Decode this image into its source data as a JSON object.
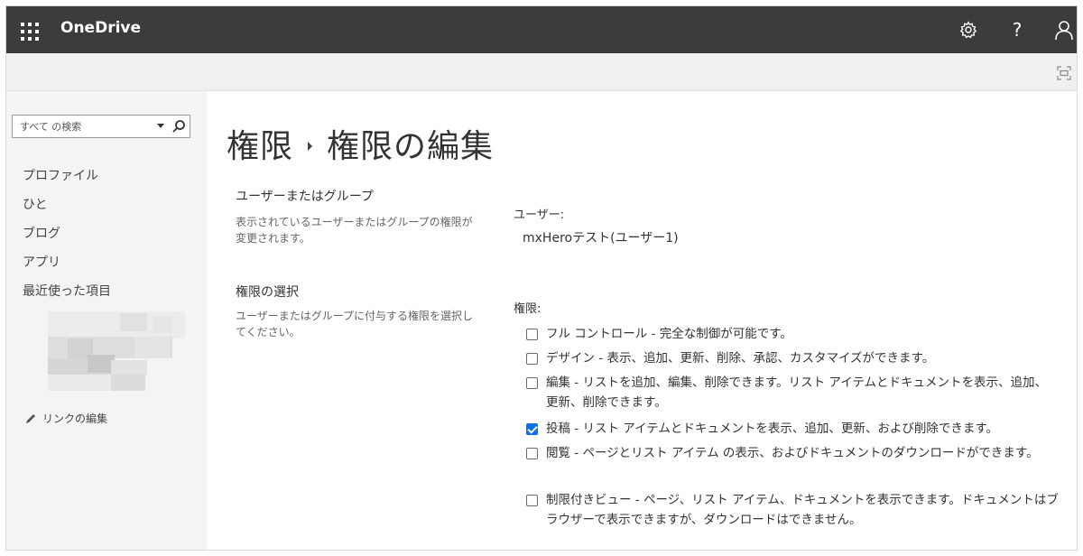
{
  "app": {
    "name": "OneDrive"
  },
  "topbar": {
    "icons": [
      "app-launcher-icon",
      "gear-icon",
      "help-icon",
      "user-icon"
    ],
    "help_glyph": "?"
  },
  "ribbon": {
    "icons": [
      "focus-mode-icon"
    ]
  },
  "sidebar": {
    "search": {
      "placeholder": "すべて の検索"
    },
    "items": [
      {
        "label": "プロファイル"
      },
      {
        "label": "ひと"
      },
      {
        "label": "ブログ"
      },
      {
        "label": "アプリ"
      },
      {
        "label": "最近使った項目"
      }
    ],
    "edit_links": "リンクの編集"
  },
  "breadcrumb": {
    "parent": "権限",
    "current": "権限の編集"
  },
  "sections": {
    "users": {
      "heading": "ユーザーまたはグループ",
      "description": "表示されているユーザーまたはグループの権限が変更されます。",
      "label": "ユーザー:",
      "value": "mxHeroテスト(ユーザー1)"
    },
    "permissions": {
      "heading": "権限の選択",
      "description": "ユーザーまたはグループに付与する権限を選択してください。",
      "label": "権限:",
      "options": [
        {
          "text": "フル コントロール - 完全な制御が可能です。",
          "checked": false
        },
        {
          "text": "デザイン - 表示、追加、更新、削除、承認、カスタマイズができます。",
          "checked": false
        },
        {
          "text": "編集 - リストを追加、編集、削除できます。リスト アイテムとドキュメントを表示、追加、更新、削除できます。",
          "checked": false
        },
        {
          "text": "投稿 - リスト アイテムとドキュメントを表示、追加、更新、および削除できます。",
          "checked": true
        },
        {
          "text": "閲覧 - ページとリスト アイテム の表示、およびドキュメントのダウンロードができます。",
          "checked": false
        },
        {
          "text": "制限付きビュー - ページ、リスト アイテム、ドキュメントを表示できます。ドキュメントはブラウザーで表示できますが、ダウンロードはできません。",
          "checked": false
        }
      ]
    }
  },
  "colors": {
    "suitebar": "#3c3c3c",
    "accent": "#0a6fe8"
  }
}
